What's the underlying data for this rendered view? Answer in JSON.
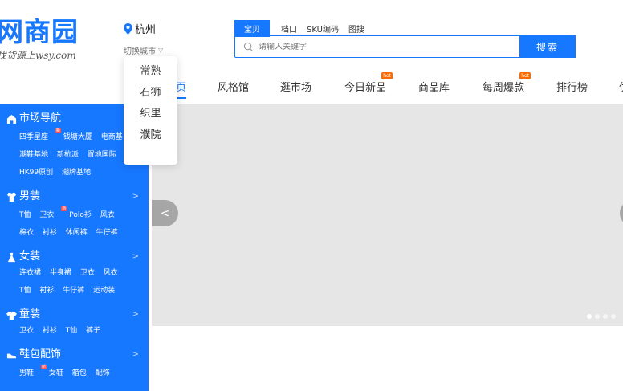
{
  "logo": {
    "main": "网商园",
    "slogan": "找货源上wsy.com"
  },
  "city": {
    "current": "杭州",
    "switch_label": "切换城市",
    "options": [
      "常熟",
      "石狮",
      "织里",
      "濮院"
    ]
  },
  "search": {
    "tabs": [
      "宝贝",
      "档口",
      "SKU编码",
      "图搜"
    ],
    "placeholder": "请输入关键字",
    "button": "搜索"
  },
  "nav": {
    "items": [
      {
        "label": "页",
        "hot": ""
      },
      {
        "label": "风格馆",
        "hot": ""
      },
      {
        "label": "逛市场",
        "hot": ""
      },
      {
        "label": "今日新品",
        "hot": "hot"
      },
      {
        "label": "商品库",
        "hot": ""
      },
      {
        "label": "每周爆款",
        "hot": "hot"
      },
      {
        "label": "排行榜",
        "hot": ""
      },
      {
        "label": "优",
        "hot": ""
      }
    ]
  },
  "sidebar": {
    "categories": [
      {
        "title": "市场导航",
        "icon": "home-icon",
        "rows": [
          [
            "四季星座",
            "钱塘大厦",
            "电商基"
          ],
          [
            "潮鞋基地",
            "新杭派",
            "置地国际"
          ],
          [
            "HK99原创",
            "潮牌基地"
          ]
        ]
      },
      {
        "title": "男装",
        "icon": "shirt-icon",
        "rows": [
          [
            "T恤",
            "卫衣",
            "Polo衫",
            "风衣"
          ],
          [
            "棉衣",
            "衬衫",
            "休闲裤",
            "牛仔裤"
          ]
        ]
      },
      {
        "title": "女装",
        "icon": "dress-icon",
        "rows": [
          [
            "连衣裙",
            "半身裙",
            "卫衣",
            "风衣"
          ],
          [
            "T恤",
            "衬衫",
            "牛仔裤",
            "运动装"
          ]
        ]
      },
      {
        "title": "童装",
        "icon": "kids-icon",
        "rows": [
          [
            "卫衣",
            "衬衫",
            "T恤",
            "裤子"
          ]
        ]
      },
      {
        "title": "鞋包配饰",
        "icon": "shoe-icon",
        "rows": [
          [
            "男鞋",
            "女鞋",
            "箱包",
            "配饰"
          ]
        ]
      }
    ],
    "new_badge": "新"
  },
  "colors": {
    "brand": "#1677ff",
    "hot": "#ff6a00",
    "banner": "#e6e6e6"
  }
}
